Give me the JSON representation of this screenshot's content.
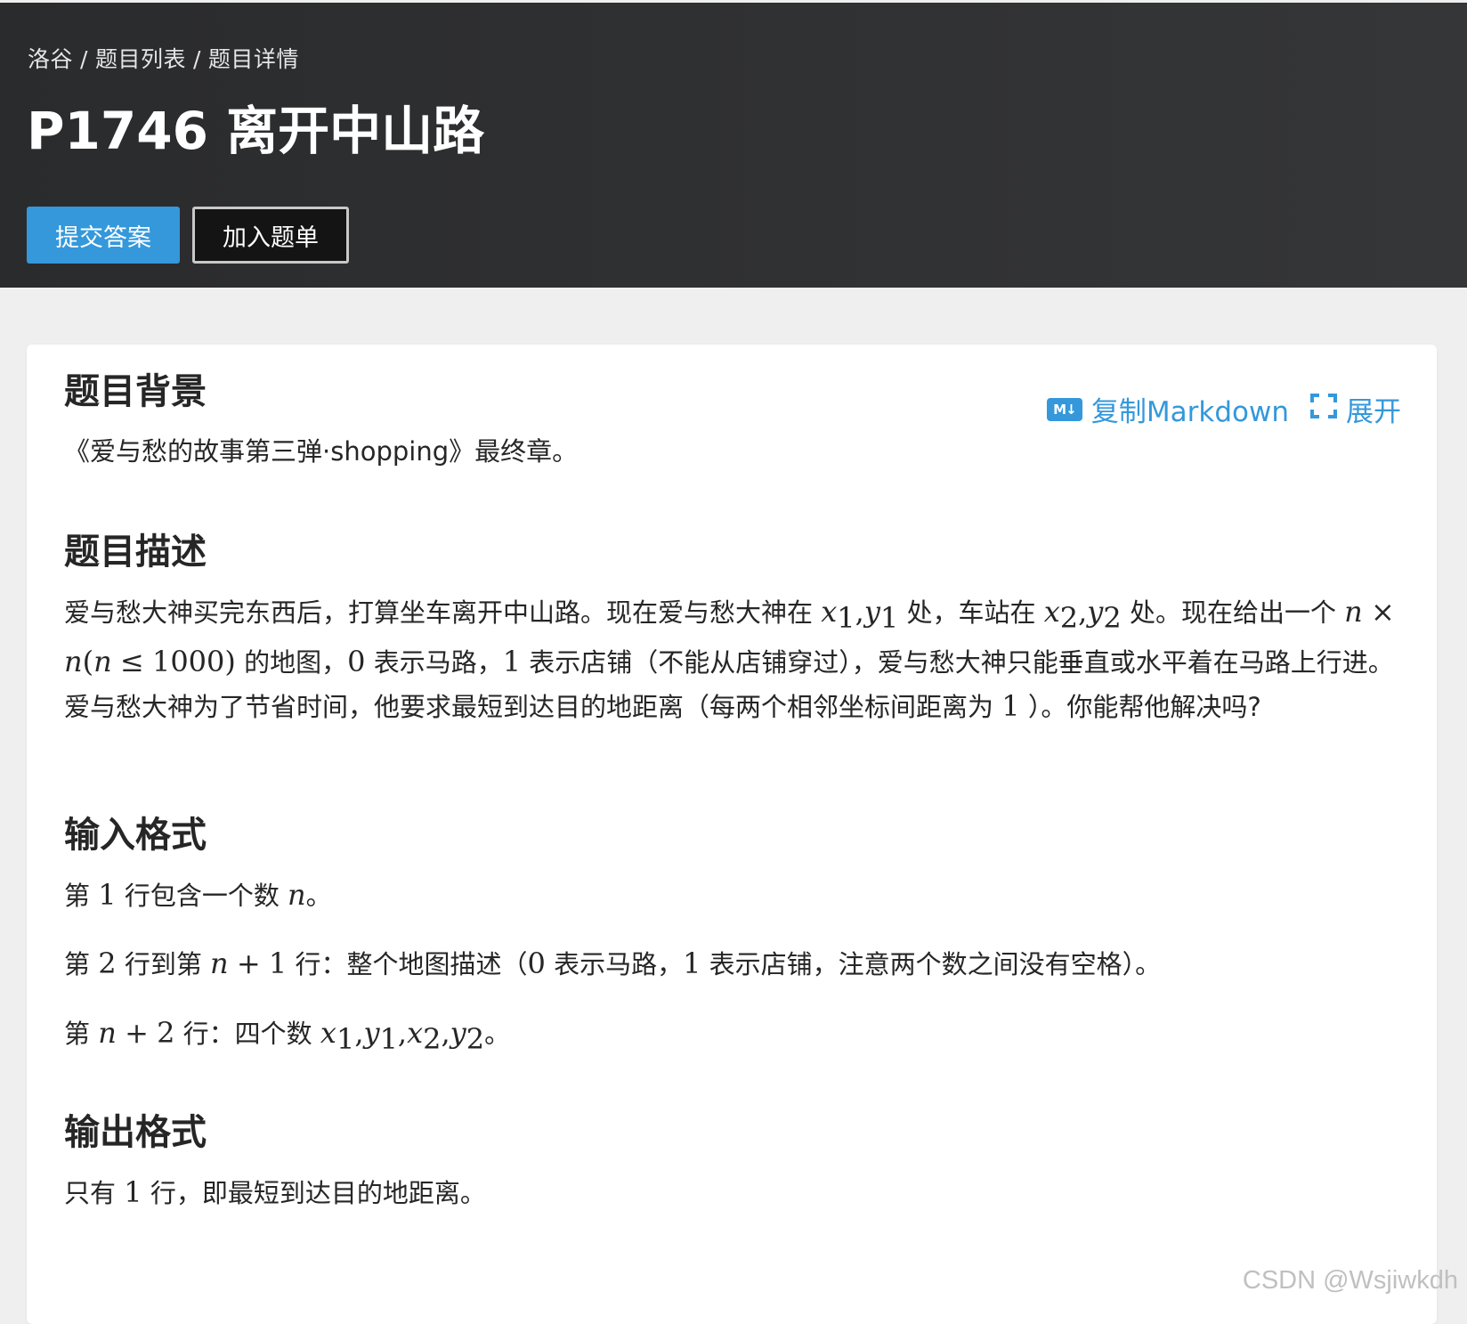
{
  "breadcrumb": [
    "洛谷",
    "题目列表",
    "题目详情"
  ],
  "title": "P1746 离开中山路",
  "buttons": {
    "submit": "提交答案",
    "add_list": "加入题单"
  },
  "tools": {
    "copy_markdown_icon": "M↓",
    "copy_markdown": "复制Markdown",
    "expand": "展开"
  },
  "sections": {
    "background": {
      "title": "题目背景",
      "text": "《爱与愁的故事第三弹·shopping》最终章。"
    },
    "description": {
      "title": "题目描述",
      "s1": "爱与愁大神买完东西后，打算坐车离开中山路。现在爱与愁大神在",
      "s2": "处，车站在",
      "s3": "处。现在给出一个",
      "s4": "的地图，",
      "s5": "表示马路，",
      "s6": "表示店铺（不能从店铺穿过），爱与愁大神只能垂直或水平着在马路上行进。爱与愁大神为了节省时间，他要求最短到达目的地距离（每两个相邻坐标间距离为",
      "s7": "）。你能帮他解决吗?"
    },
    "input": {
      "title": "输入格式",
      "l1a": "第",
      "l1b": "行包含一个数",
      "l1c": "。",
      "l2a": "第",
      "l2b": "行到第",
      "l2c": "行：整个地图描述（",
      "l2d": "表示马路，",
      "l2e": "表示店铺，注意两个数之间没有空格）。",
      "l3a": "第",
      "l3b": "行：四个数",
      "l3c": "。"
    },
    "output": {
      "title": "输出格式",
      "t1": "只有",
      "t2": "行，即最短到达目的地距离。"
    }
  },
  "math": {
    "x": "x",
    "y": "y",
    "n": "n",
    "one": "1",
    "two": "2",
    "zero": "0",
    "comma": ",",
    "plus": "+",
    "times": "×",
    "leq": "≤",
    "lparen": "(",
    "rparen": ")",
    "thousand": "1000"
  },
  "watermark": "CSDN @Wsjiwkdh"
}
